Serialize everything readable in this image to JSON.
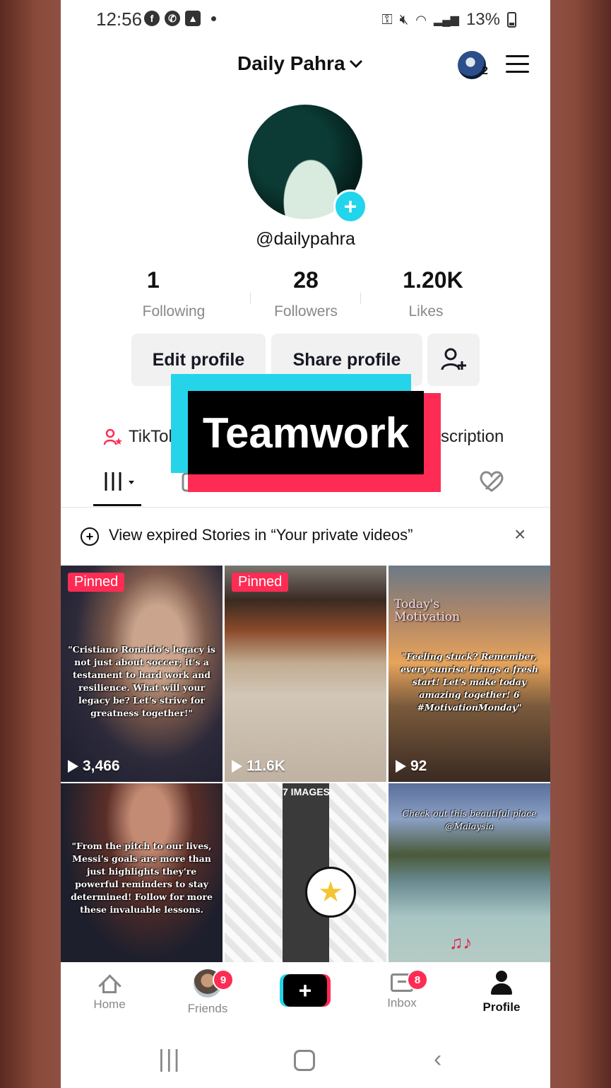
{
  "status_bar": {
    "time": "12:56",
    "battery": "13%",
    "app_icons": [
      "facebook-icon",
      "whatsapp-icon",
      "gallery-icon"
    ]
  },
  "header": {
    "title": "Daily Pahra",
    "account_count": "2"
  },
  "profile": {
    "username": "@dailypahra",
    "stats": [
      {
        "value": "1",
        "label": "Following"
      },
      {
        "value": "28",
        "label": "Followers"
      },
      {
        "value": "1.20K",
        "label": "Likes"
      }
    ],
    "edit_button": "Edit profile",
    "share_button": "Share profile",
    "link_left": "TikTok",
    "link_right": "scription"
  },
  "overlay": {
    "text": "Teamwork"
  },
  "banner": {
    "text": "View expired Stories in “Your private videos”"
  },
  "videos": [
    {
      "pinned": "Pinned",
      "views": "3,466",
      "caption": "\"Cristiano Ronaldo's legacy is not just about soccer; it's a testament to hard work and resilience. What will your legacy be? Let's strive for greatness together!\""
    },
    {
      "pinned": "Pinned",
      "views": "11.6K"
    },
    {
      "views": "92",
      "heading": "Today's Motivation",
      "caption": "\"Feeling stuck? Remember, every sunrise brings a fresh start! Let's make today amazing together! 6 #MotivationMonday\""
    },
    {
      "caption": "\"From the pitch to our lives, Messi's goals are more than just highlights they're powerful reminders to stay determined! Follow for more these invaluable lessons."
    },
    {
      "tag": "7 IMAGES"
    },
    {
      "caption": "Check out this beautiful place @Malaysia"
    }
  ],
  "nav": {
    "home": "Home",
    "friends": "Friends",
    "friends_badge": "9",
    "create": "+",
    "inbox": "Inbox",
    "inbox_badge": "8",
    "profile": "Profile"
  },
  "colors": {
    "accent_red": "#fe2c55",
    "accent_cyan": "#25d4e9",
    "text_dark": "#161823"
  }
}
